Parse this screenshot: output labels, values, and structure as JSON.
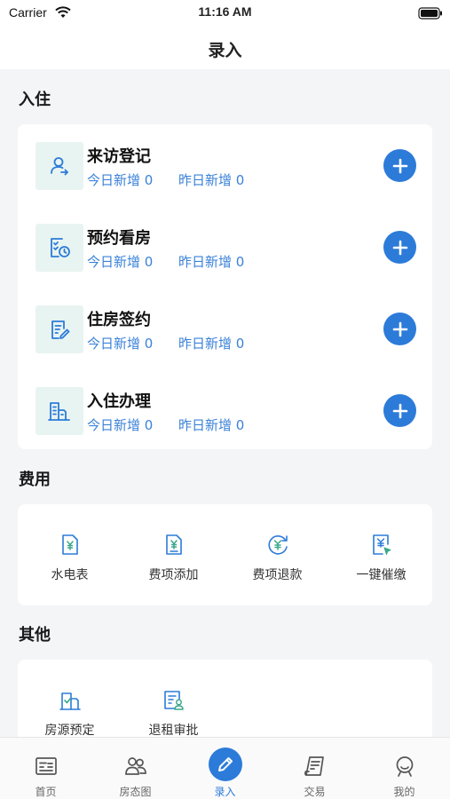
{
  "status_bar": {
    "carrier": "Carrier",
    "time": "11:16 AM"
  },
  "nav": {
    "title": "录入"
  },
  "sections": {
    "checkin": {
      "title": "入住",
      "rows": [
        {
          "title": "来访登记",
          "today": "今日新增 0",
          "yesterday": "昨日新增 0",
          "icon": "visitor-icon"
        },
        {
          "title": "预约看房",
          "today": "今日新增 0",
          "yesterday": "昨日新增 0",
          "icon": "appointment-icon"
        },
        {
          "title": "住房签约",
          "today": "今日新增 0",
          "yesterday": "昨日新增 0",
          "icon": "contract-icon"
        },
        {
          "title": "入住办理",
          "today": "今日新增 0",
          "yesterday": "昨日新增 0",
          "icon": "building-icon"
        }
      ]
    },
    "fees": {
      "title": "费用",
      "items": [
        {
          "label": "水电表",
          "icon": "meter-icon"
        },
        {
          "label": "费项添加",
          "icon": "fee-add-icon"
        },
        {
          "label": "费项退款",
          "icon": "fee-refund-icon"
        },
        {
          "label": "一键催缴",
          "icon": "payment-reminder-icon"
        }
      ]
    },
    "other": {
      "title": "其他",
      "items": [
        {
          "label": "房源预定",
          "icon": "room-reserve-icon"
        },
        {
          "label": "退租审批",
          "icon": "checkout-approval-icon"
        }
      ]
    }
  },
  "tab_bar": {
    "active": "录入",
    "items": [
      {
        "label": "首页",
        "icon": "home-icon"
      },
      {
        "label": "房态图",
        "icon": "room-status-icon"
      },
      {
        "label": "录入",
        "icon": "edit-icon"
      },
      {
        "label": "交易",
        "icon": "transaction-icon"
      },
      {
        "label": "我的",
        "icon": "profile-icon"
      }
    ]
  },
  "colors": {
    "accent": "#2c7bd9",
    "icon_bg": "#e8f4f1",
    "teal": "#3aa88c",
    "page_bg": "#f4f5f7"
  }
}
